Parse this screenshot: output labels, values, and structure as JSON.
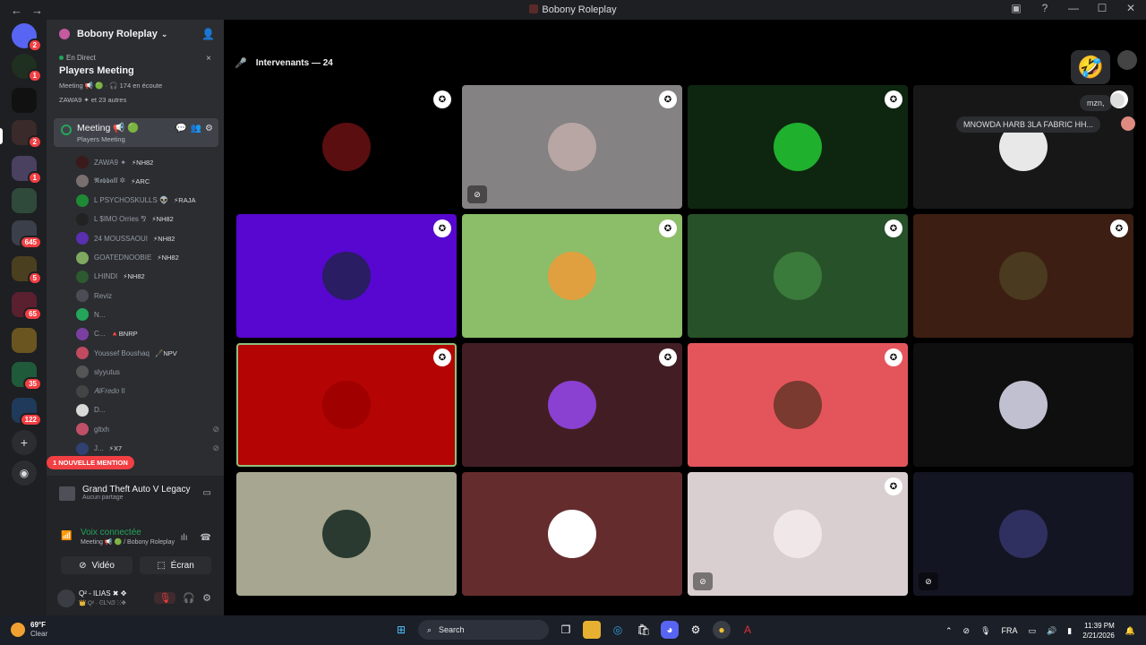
{
  "window": {
    "title": "Bobony Roleplay",
    "back": "←",
    "forward": "→"
  },
  "guild_badges": [
    "2",
    "1",
    "2",
    "1",
    "645",
    "5",
    "65",
    "35",
    "122"
  ],
  "server": {
    "name": "Bobony Roleplay"
  },
  "stage_card": {
    "live": "En Direct",
    "name": "Players Meeting",
    "meta": "Meeting 📢 🟢 · 🎧 174 en écoute",
    "speakers": "ZAWA9 ✦ et 23 autres",
    "close": "×"
  },
  "channel": {
    "name": "Meeting 📢 🟢",
    "topic": "Players Meeting"
  },
  "members": [
    {
      "name": "ZAWA9 ✦",
      "tag": "⚡NH82",
      "color": "#3a1a1a",
      "muted": false
    },
    {
      "name": "𝕽𝖔𝖇𝖇𝖆𝖑𝖑 ✲",
      "tag": "⚡ARC",
      "color": "#7a6f6f",
      "muted": false
    },
    {
      "name": "L PSYCHOSKULLS 👽",
      "tag": "⚡RAJA",
      "color": "#1f8a35",
      "muted": false
    },
    {
      "name": "L $IMO Orries ⅋",
      "tag": "⚡NH82",
      "color": "#222",
      "muted": false
    },
    {
      "name": "24 MOUSSAOUI",
      "tag": "⚡NH82",
      "color": "#5a2fb0",
      "muted": false
    },
    {
      "name": "GOATEDNOOBIE",
      "tag": "⚡NH82",
      "color": "#7fa860",
      "muted": false
    },
    {
      "name": "LHINDI",
      "tag": "⚡NH82",
      "color": "#2d5a30",
      "muted": false
    },
    {
      "name": "Reviz",
      "tag": "",
      "color": "#4a4d55",
      "muted": false
    },
    {
      "name": "N...",
      "tag": "",
      "color": "#23a55a",
      "muted": false
    },
    {
      "name": "C...",
      "tag": "🔺BNRP",
      "color": "#7a3fa0",
      "muted": false
    },
    {
      "name": "Youssef Boushaq",
      "tag": "🖋️NPV",
      "color": "#c04a60",
      "muted": false
    },
    {
      "name": "slyyutus",
      "tag": "",
      "color": "#555",
      "muted": false
    },
    {
      "name": "𝐴𝑙𝐹𝑟𝑒𝑑𝑜 ⅼⅼ",
      "tag": "",
      "color": "#444",
      "muted": false
    },
    {
      "name": "D...",
      "tag": "",
      "color": "#d9d9d9",
      "muted": false
    },
    {
      "name": "gltxh",
      "tag": "",
      "color": "#c05068",
      "muted": true
    },
    {
      "name": "J...",
      "tag": "⚡X7",
      "color": "#304070",
      "muted": true
    }
  ],
  "new_mention": "1 NOUVELLE MENTION",
  "activity": {
    "game": "Grand Theft Auto V Legacy",
    "status": "Aucun partage"
  },
  "voice": {
    "status": "Voix connectée",
    "location": "Meeting 📢 🟢 / Bobony Roleplay"
  },
  "buttons": {
    "video": "Vidéo",
    "screen": "Écran"
  },
  "me": {
    "name": "Q² - ILIAS ✖ ✥",
    "sub": "👑 Q² · ᕮᒪᓭᘎ ⵘ✥"
  },
  "stage": {
    "speakers_label": "Intervenants — 24",
    "reaction": "🤣"
  },
  "tiles": [
    {
      "bg": "#000000",
      "av": "#5a0e10",
      "shield": true,
      "off": false,
      "speaking": false
    },
    {
      "bg": "#858283",
      "av": "#b8a6a4",
      "shield": true,
      "off": true,
      "speaking": false
    },
    {
      "bg": "#0e260f",
      "av": "#1fb02e",
      "shield": true,
      "off": false,
      "speaking": false
    },
    {
      "bg": "#171717",
      "av": "#e8e8e8",
      "shield": true,
      "off": false,
      "speaking": false
    },
    {
      "bg": "#5707cf",
      "av": "#2a1d63",
      "shield": true,
      "off": false,
      "speaking": false
    },
    {
      "bg": "#8cbe69",
      "av": "#e0a040",
      "shield": true,
      "off": false,
      "speaking": false
    },
    {
      "bg": "#275128",
      "av": "#3a7a3a",
      "shield": true,
      "off": false,
      "speaking": false
    },
    {
      "bg": "#3c1e12",
      "av": "#4a3a20",
      "shield": true,
      "off": false,
      "speaking": false
    },
    {
      "bg": "#b40404",
      "av": "#a00000",
      "shield": true,
      "off": false,
      "speaking": true
    },
    {
      "bg": "#421e24",
      "av": "#8a40d0",
      "shield": true,
      "off": false,
      "speaking": false
    },
    {
      "bg": "#e4555b",
      "av": "#7a3a30",
      "shield": true,
      "off": false,
      "speaking": false
    },
    {
      "bg": "#0f0f0f",
      "av": "#c0c0d0",
      "shield": false,
      "off": false,
      "speaking": false
    },
    {
      "bg": "#a7a690",
      "av": "#2a3a30",
      "shield": false,
      "off": false,
      "speaking": false
    },
    {
      "bg": "#652c2e",
      "av": "#ffffff",
      "shield": false,
      "off": false,
      "speaking": false
    },
    {
      "bg": "#d9cfd1",
      "av": "#f0e8e8",
      "shield": true,
      "off": true,
      "speaking": false
    },
    {
      "bg": "#141522",
      "av": "#303060",
      "shield": false,
      "off": true,
      "speaking": false
    }
  ],
  "bubbles": {
    "a": "mzn,",
    "b": "MNOWDA HARB 3LA FABRIC HH..."
  },
  "taskbar": {
    "temp": "69°F",
    "weather": "Clear",
    "search": "Search",
    "lang": "FRA",
    "time": "11:39 PM",
    "date": "2/21/2026"
  }
}
